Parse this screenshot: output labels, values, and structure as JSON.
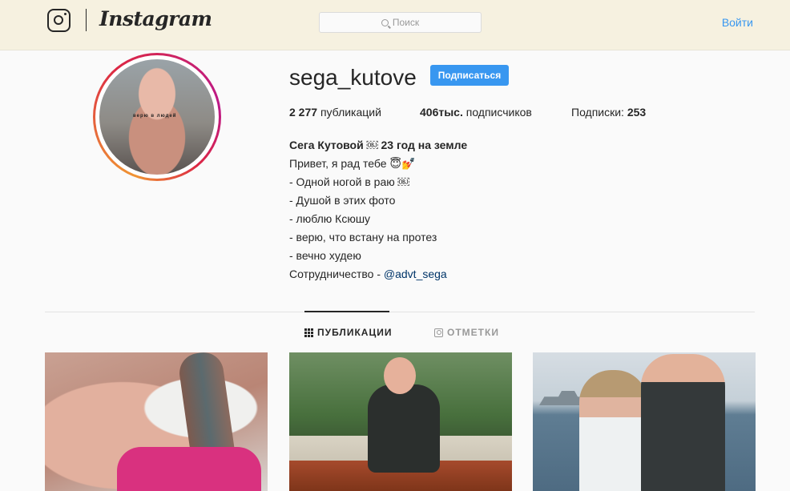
{
  "header": {
    "brand": "Instagram",
    "search_placeholder": "Поиск",
    "login_label": "Войти"
  },
  "profile": {
    "username": "sega_kutove",
    "follow_label": "Подписаться",
    "stats": {
      "posts_value": "2 277",
      "posts_label": "публикаций",
      "followers_value": "406тыс.",
      "followers_label": "подписчиков",
      "following_label": "Подписки:",
      "following_value": "253"
    },
    "bio": {
      "name_line": "Сега Кутовой ￼ 23 год на земле",
      "lines": [
        "Привет, я рад тебе 😇💅",
        "- Одной ногой в раю ￼",
        "- Душой в этих фото",
        "- люблю Ксюшу",
        "- верю, что встану на протез",
        "- вечно худею"
      ],
      "collab_prefix": "Сотрудничество - ",
      "collab_link": "@advt_sega"
    },
    "avatar_tattoo_text": "верю  в людей"
  },
  "tabs": [
    {
      "label": "ПУБЛИКАЦИИ",
      "icon": "grid-icon",
      "active": true
    },
    {
      "label": "ОТМЕТКИ",
      "icon": "tagged-icon",
      "active": false
    }
  ],
  "colors": {
    "accent": "#3897f0",
    "header_bg": "#f6f1e0",
    "link": "#003569"
  }
}
